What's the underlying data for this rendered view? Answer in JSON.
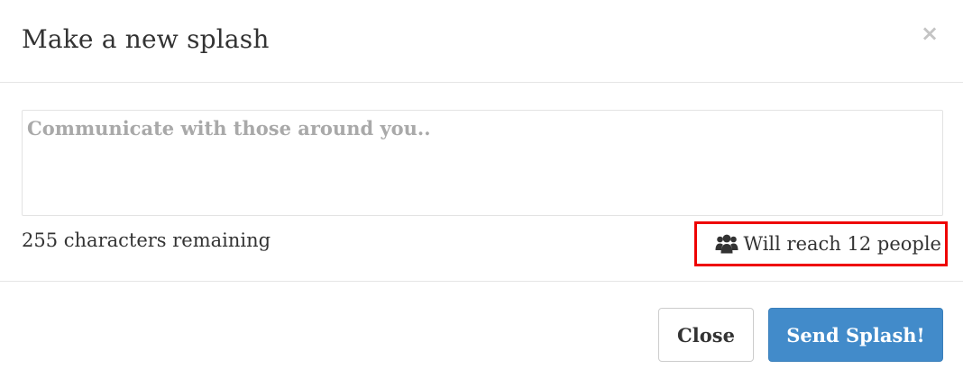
{
  "modal": {
    "title": "Make a new splash",
    "close_icon": "close-icon"
  },
  "composer": {
    "placeholder": "Communicate with those around you..",
    "value": "",
    "chars_remaining_text": "255 characters remaining",
    "reach_icon": "users-icon",
    "reach_text": "Will reach 12 people",
    "highlight_color": "#ee0000"
  },
  "footer": {
    "close_label": "Close",
    "send_label": "Send Splash!",
    "send_color": "#428bca"
  }
}
